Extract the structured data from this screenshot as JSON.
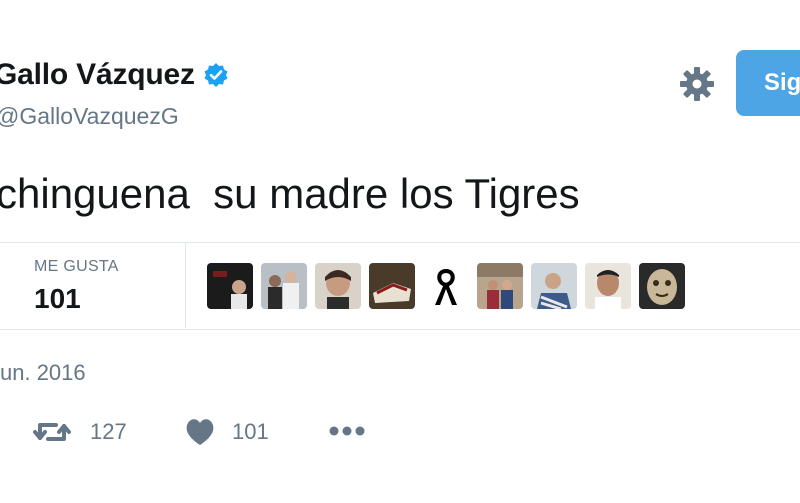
{
  "user": {
    "display_name": "Gallo Vázquez",
    "handle": "@GalloVazquezG"
  },
  "follow_button": {
    "label": "Sig"
  },
  "tweet": {
    "text": "chinguena  su madre los Tigres"
  },
  "stats": {
    "likes_label": "ME GUSTA",
    "likes_count": "101"
  },
  "timestamp": "un. 2016",
  "actions": {
    "retweet_count": "127",
    "like_count": "101"
  },
  "icons": {
    "verified": "verified-badge-icon",
    "settings": "gear-icon",
    "retweet": "retweet-icon",
    "like": "heart-icon",
    "more": "more-dots-icon"
  },
  "colors": {
    "follow_button": "#4ea5e5",
    "verified": "#1da1f2",
    "muted_text": "#657786",
    "icon_gray": "#657786",
    "divider": "#e1e8ed"
  }
}
